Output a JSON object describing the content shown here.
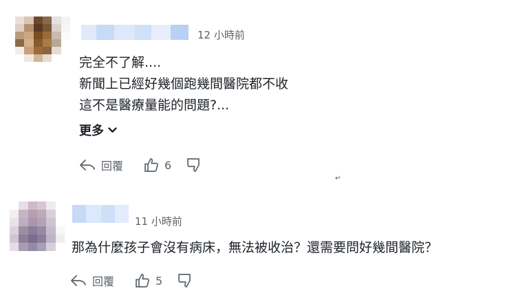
{
  "comments": [
    {
      "time": "12 小時前",
      "lines": [
        "完全不了解....",
        "新聞上已經好幾個跑幾間醫院都不收",
        "這不是醫療量能的問題?..."
      ],
      "more_label": "更多",
      "reply_label": "回覆",
      "likes": "6"
    },
    {
      "time": "11 小時前",
      "lines": [
        "那為什麼孩子會沒有病床，無法被收治？還需要問好幾間醫院？"
      ],
      "reply_label": "回覆",
      "likes": "5"
    }
  ],
  "colors": {
    "text": "#1d2228",
    "secondary": "#5b636a",
    "icon": "#5b636a"
  },
  "icons": [
    "reply-icon",
    "thumbs-up-icon",
    "thumbs-down-icon",
    "chevron-down-icon"
  ]
}
